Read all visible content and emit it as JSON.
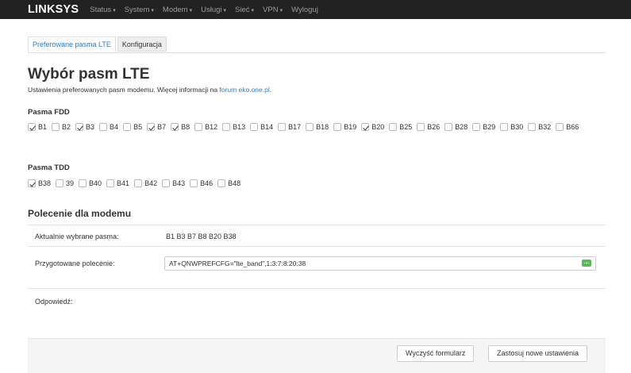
{
  "navbar": {
    "brand": "LINKSYS",
    "items": [
      {
        "label": "Status",
        "dropdown": true
      },
      {
        "label": "System",
        "dropdown": true
      },
      {
        "label": "Modem",
        "dropdown": true
      },
      {
        "label": "Usługi",
        "dropdown": true
      },
      {
        "label": "Sieć",
        "dropdown": true
      },
      {
        "label": "VPN",
        "dropdown": true
      },
      {
        "label": "Wyloguj",
        "dropdown": false
      }
    ]
  },
  "tabs": [
    {
      "label": "Preferowane pasma LTE",
      "active": true
    },
    {
      "label": "Konfiguracja",
      "active": false
    }
  ],
  "page": {
    "title": "Wybór pasm LTE",
    "description": "Ustawienia preferowanych pasm modemu. Więcej informacji na",
    "link": "forum eko.one.pl",
    "link_suffix": "."
  },
  "fdd": {
    "title": "Pasma FDD",
    "bands": [
      {
        "label": "B1",
        "checked": true
      },
      {
        "label": "B2",
        "checked": false
      },
      {
        "label": "B3",
        "checked": true
      },
      {
        "label": "B4",
        "checked": false
      },
      {
        "label": "B5",
        "checked": false
      },
      {
        "label": "B7",
        "checked": true
      },
      {
        "label": "B8",
        "checked": true
      },
      {
        "label": "B12",
        "checked": false
      },
      {
        "label": "B13",
        "checked": false
      },
      {
        "label": "B14",
        "checked": false
      },
      {
        "label": "B17",
        "checked": false
      },
      {
        "label": "B18",
        "checked": false
      },
      {
        "label": "B19",
        "checked": false
      },
      {
        "label": "B20",
        "checked": true
      },
      {
        "label": "B25",
        "checked": false
      },
      {
        "label": "B26",
        "checked": false
      },
      {
        "label": "B28",
        "checked": false
      },
      {
        "label": "B29",
        "checked": false
      },
      {
        "label": "B30",
        "checked": false
      },
      {
        "label": "B32",
        "checked": false
      },
      {
        "label": "B66",
        "checked": false
      }
    ]
  },
  "tdd": {
    "title": "Pasma TDD",
    "bands": [
      {
        "label": "B38",
        "checked": true
      },
      {
        "label": "39",
        "checked": false
      },
      {
        "label": "B40",
        "checked": false
      },
      {
        "label": "B41",
        "checked": false
      },
      {
        "label": "B42",
        "checked": false
      },
      {
        "label": "B43",
        "checked": false
      },
      {
        "label": "B46",
        "checked": false
      },
      {
        "label": "B48",
        "checked": false
      }
    ]
  },
  "modem": {
    "title": "Polecenie dla modemu",
    "current_label": "Aktualnie wybrane pasma:",
    "current_value": "B1 B3 B7 B8 B20 B38",
    "command_label": "Przygotowane polecenie:",
    "command_value": "AT+QNWPREFCFG=\"lte_band\",1:3:7:8:20:38",
    "response_label": "Odpowiedź:"
  },
  "footer": {
    "clear_label": "Wyczyść formularz",
    "apply_label": "Zastosuj nowe ustawienia"
  },
  "colors": {
    "navbar_bg": "#222222",
    "link": "#337ab7",
    "chat_icon": "#5cb85c"
  }
}
